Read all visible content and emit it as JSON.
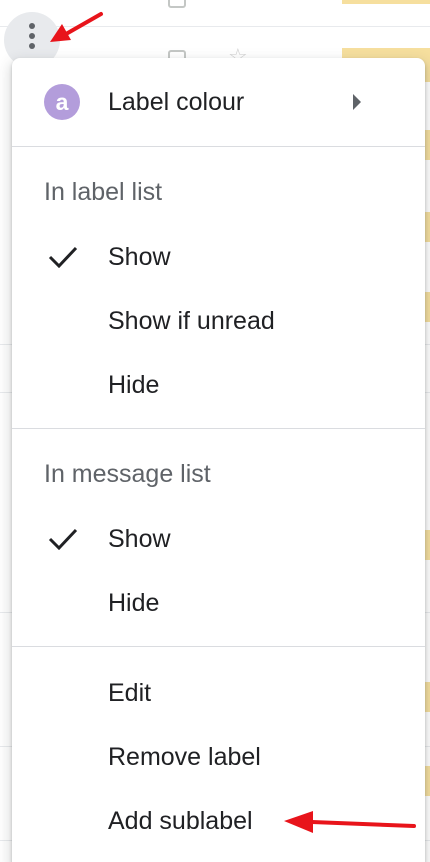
{
  "colors": {
    "avatar_bg": "#b39ddb",
    "highlight": "#f6df9e",
    "annotation": "#e8141b"
  },
  "toolbar": {
    "more_icon": "more-vert-icon"
  },
  "menu": {
    "label_colour": {
      "avatar_letter": "a",
      "label": "Label colour",
      "submenu_icon": "arrow-right-icon"
    },
    "label_list": {
      "header": "In label list",
      "options": [
        {
          "label": "Show",
          "checked": true
        },
        {
          "label": "Show if unread",
          "checked": false
        },
        {
          "label": "Hide",
          "checked": false
        }
      ]
    },
    "message_list": {
      "header": "In message list",
      "options": [
        {
          "label": "Show",
          "checked": true
        },
        {
          "label": "Hide",
          "checked": false
        }
      ]
    },
    "actions": [
      {
        "label": "Edit"
      },
      {
        "label": "Remove label"
      },
      {
        "label": "Add sublabel"
      }
    ]
  }
}
